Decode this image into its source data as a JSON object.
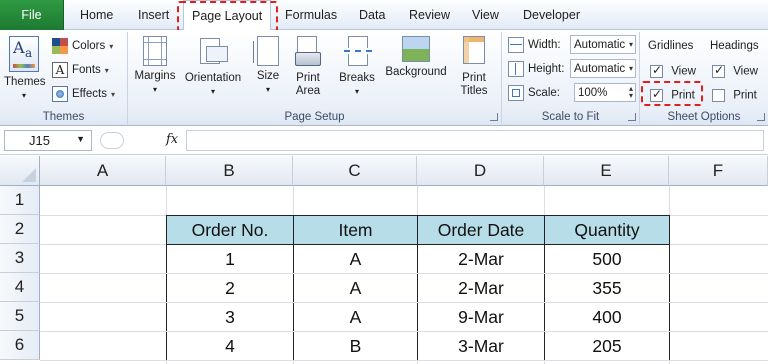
{
  "tabs": {
    "file": "File",
    "items": [
      "Home",
      "Insert",
      "Page Layout",
      "Formulas",
      "Data",
      "Review",
      "View",
      "Developer"
    ]
  },
  "ribbon": {
    "themes": {
      "themes_label": "Themes",
      "colors_label": "Colors",
      "fonts_label": "Fonts",
      "effects_label": "Effects",
      "group_label": "Themes"
    },
    "page_setup": {
      "margins": "Margins",
      "orientation": "Orientation",
      "size": "Size",
      "print_area_line1": "Print",
      "print_area_line2": "Area",
      "breaks": "Breaks",
      "background": "Background",
      "print_titles_line1": "Print",
      "print_titles_line2": "Titles",
      "group_label": "Page Setup"
    },
    "scale_to_fit": {
      "width_label": "Width:",
      "width_value": "Automatic",
      "height_label": "Height:",
      "height_value": "Automatic",
      "scale_label": "Scale:",
      "scale_value": "100%",
      "group_label": "Scale to Fit"
    },
    "sheet_options": {
      "gridlines": "Gridlines",
      "headings": "Headings",
      "gridlines_view": "View",
      "gridlines_print": "Print",
      "headings_view": "View",
      "headings_print": "Print",
      "group_label": "Sheet Options"
    }
  },
  "formula_bar": {
    "name_box": "J15",
    "fx": "fx"
  },
  "grid": {
    "columns": [
      "A",
      "B",
      "C",
      "D",
      "E",
      "F"
    ],
    "rows": [
      "1",
      "2",
      "3",
      "4",
      "5",
      "6"
    ],
    "table": {
      "headers": [
        "Order No.",
        "Item",
        "Order Date",
        "Quantity"
      ],
      "rows": [
        [
          "1",
          "A",
          "2-Mar",
          "500"
        ],
        [
          "2",
          "A",
          "2-Mar",
          "355"
        ],
        [
          "3",
          "A",
          "9-Mar",
          "400"
        ],
        [
          "4",
          "B",
          "3-Mar",
          "205"
        ]
      ]
    }
  },
  "colors": {
    "file_tab": "#1d7a31",
    "table_header_fill": "#b7dde8",
    "highlight_dash": "#e02020"
  }
}
